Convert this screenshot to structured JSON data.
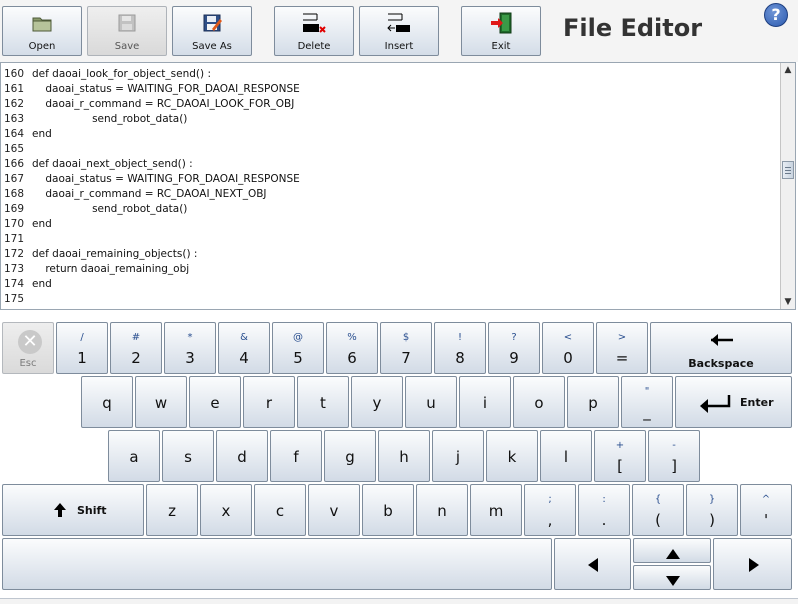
{
  "app": {
    "title": "File Editor",
    "help_label": "?"
  },
  "toolbar": {
    "open": "Open",
    "save": "Save",
    "save_as": "Save As",
    "delete": "Delete",
    "insert": "Insert",
    "exit": "Exit"
  },
  "editor": {
    "lines": [
      {
        "num": "160",
        "text": "def daoai_look_for_object_send() :"
      },
      {
        "num": "161",
        "text": "    daoai_status = WAITING_FOR_DAOAI_RESPONSE"
      },
      {
        "num": "162",
        "text": "    daoai_r_command = RC_DAOAI_LOOK_FOR_OBJ"
      },
      {
        "num": "163",
        "text": "                  send_robot_data()"
      },
      {
        "num": "164",
        "text": "end"
      },
      {
        "num": "165",
        "text": ""
      },
      {
        "num": "166",
        "text": "def daoai_next_object_send() :"
      },
      {
        "num": "167",
        "text": "    daoai_status = WAITING_FOR_DAOAI_RESPONSE"
      },
      {
        "num": "168",
        "text": "    daoai_r_command = RC_DAOAI_NEXT_OBJ"
      },
      {
        "num": "169",
        "text": "                  send_robot_data()"
      },
      {
        "num": "170",
        "text": "end"
      },
      {
        "num": "171",
        "text": ""
      },
      {
        "num": "172",
        "text": "def daoai_remaining_objects() :"
      },
      {
        "num": "173",
        "text": "    return daoai_remaining_obj"
      },
      {
        "num": "174",
        "text": "end"
      },
      {
        "num": "175",
        "text": ""
      }
    ]
  },
  "keyboard": {
    "esc": "Esc",
    "row1": [
      {
        "top": "/",
        "main": "1"
      },
      {
        "top": "#",
        "main": "2"
      },
      {
        "top": "*",
        "main": "3"
      },
      {
        "top": "&",
        "main": "4"
      },
      {
        "top": "@",
        "main": "5"
      },
      {
        "top": "%",
        "main": "6"
      },
      {
        "top": "$",
        "main": "7"
      },
      {
        "top": "!",
        "main": "8"
      },
      {
        "top": "?",
        "main": "9"
      },
      {
        "top": "<",
        "main": "0"
      },
      {
        "top": ">",
        "main": "="
      }
    ],
    "backspace": "Backspace",
    "row2": [
      "q",
      "w",
      "e",
      "r",
      "t",
      "y",
      "u",
      "i",
      "o",
      "p"
    ],
    "row2_extra": {
      "top": "\"",
      "main": "_"
    },
    "enter": "Enter",
    "row3": [
      "a",
      "s",
      "d",
      "f",
      "g",
      "h",
      "j",
      "k",
      "l"
    ],
    "row3_extra": [
      {
        "top": "+",
        "main": "["
      },
      {
        "top": "-",
        "main": "]"
      }
    ],
    "shift": "Shift",
    "row4": [
      "z",
      "x",
      "c",
      "v",
      "b",
      "n",
      "m"
    ],
    "row4_extra": [
      {
        "top": ";",
        "main": ","
      },
      {
        "top": ":",
        "main": "."
      },
      {
        "top": "{",
        "main": "("
      },
      {
        "top": "}",
        "main": ")"
      },
      {
        "top": "^",
        "main": "'"
      }
    ]
  }
}
